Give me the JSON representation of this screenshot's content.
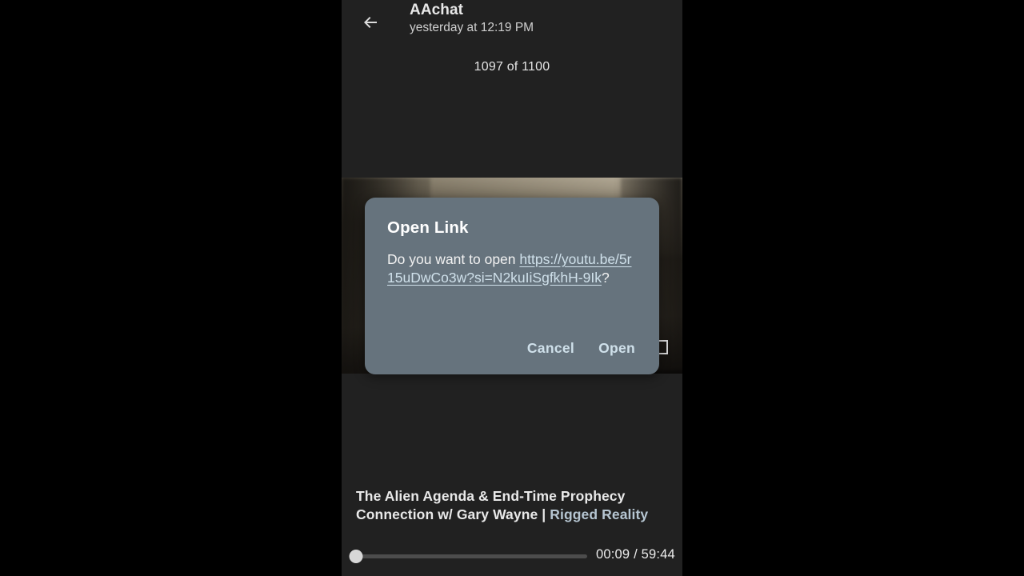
{
  "appbar": {
    "back_icon": "arrow-left-icon",
    "chat_title": "AAchat",
    "chat_subtitle": "yesterday at 12:19 PM",
    "pip_icon": "picture-in-picture-icon",
    "share_icon": "share-arrow-icon",
    "more_icon": "overflow-menu-icon"
  },
  "counter": {
    "text": "1097 of 1100"
  },
  "dialog": {
    "title": "Open Link",
    "message_prefix": "Do you want to open ",
    "link_text": "https://youtu.be/5r15uDwCo3w?si=N2kuIiSgfkhH-9Ik",
    "message_suffix": "?",
    "cancel_label": "Cancel",
    "open_label": "Open",
    "background_color": "#66737d",
    "link_color": "#cfe0ea"
  },
  "video": {
    "fullscreen_icon": "fullscreen-expand-icon",
    "title_main": "The Alien Agenda & End-Time Prophecy Connection w/ Gary Wayne | ",
    "title_line1": "The Alien Agenda & End-Time Prophecy",
    "title_line2": "Connection w/ Gary Wayne | ",
    "channel": "Rigged Reality",
    "current_time": "00:09",
    "duration": "59:44",
    "time_label": "00:09 / 59:44",
    "progress_percent": 0.25
  },
  "theme": {
    "page_background": "#000000",
    "app_background": "#212121",
    "text_primary": "#e9e9e9",
    "accent": "#b6c6d2"
  }
}
